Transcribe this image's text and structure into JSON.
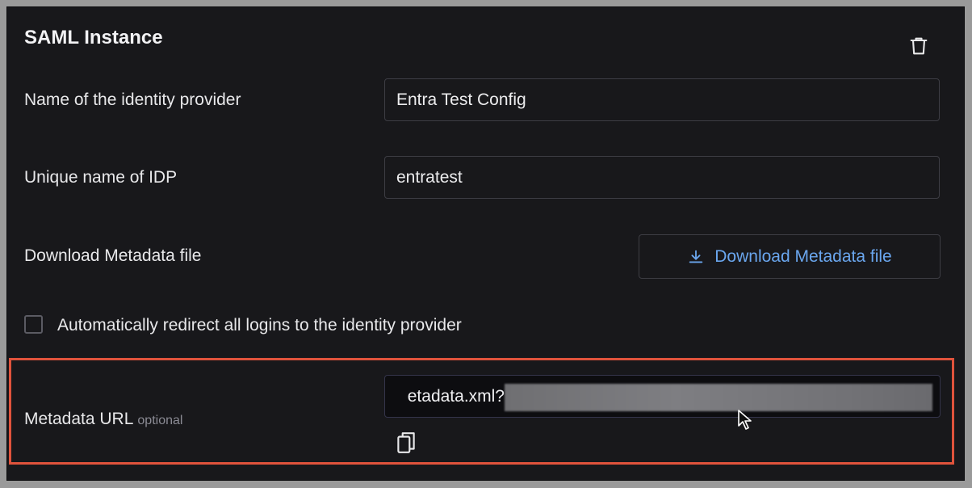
{
  "panel": {
    "title": "SAML Instance",
    "delete_icon": "trash-icon"
  },
  "fields": {
    "idp_name": {
      "label": "Name of the identity provider",
      "value": "Entra Test Config"
    },
    "idp_unique": {
      "label": "Unique name of IDP",
      "value": "entratest"
    }
  },
  "metadata_download": {
    "label": "Download Metadata file",
    "button_label": "Download Metadata file",
    "button_icon": "download-icon"
  },
  "redirect": {
    "label": "Automatically redirect all logins to the identity provider",
    "checked": false
  },
  "metadata_url": {
    "label": "Metadata URL",
    "optional_label": "optional",
    "visible_value": "etadata.xml?",
    "copy_icon": "copy-icon"
  },
  "colors": {
    "accent_link": "#6aa6ee",
    "highlight": "#e0533c",
    "background": "#18181b"
  }
}
